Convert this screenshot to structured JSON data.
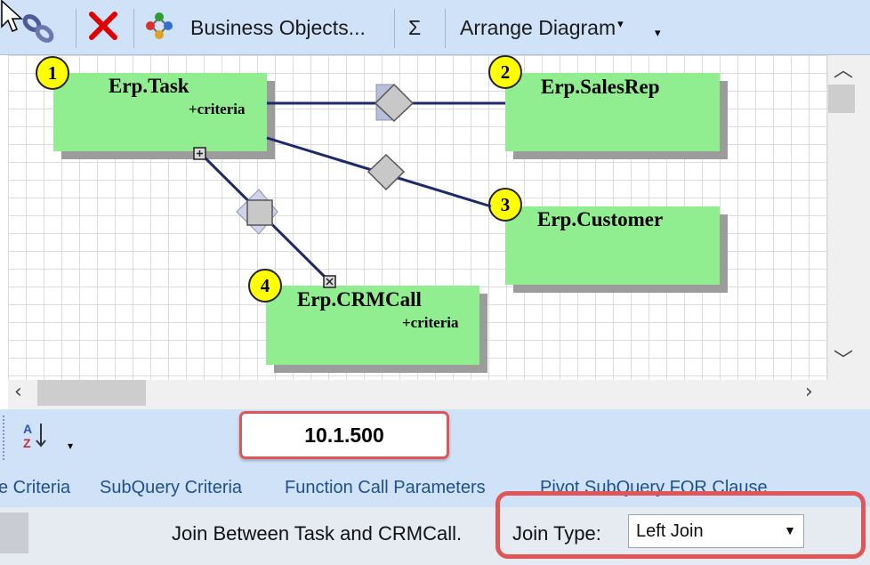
{
  "toolbar": {
    "business_objects_label": "Business Objects...",
    "sum_label": "Σ",
    "arrange_label": "Arrange Diagram",
    "arrange_caret": "▾",
    "overflow_caret": "▾"
  },
  "diagram": {
    "entities": [
      {
        "badge": "1",
        "name": "Erp.Task",
        "criteria": "+criteria"
      },
      {
        "badge": "2",
        "name": "Erp.SalesRep",
        "criteria": ""
      },
      {
        "badge": "3",
        "name": "Erp.Customer",
        "criteria": ""
      },
      {
        "badge": "4",
        "name": "Erp.CRMCall",
        "criteria": "+criteria"
      }
    ]
  },
  "properties": {
    "sort_icon_text": "A↓Z",
    "sort_caret": "▾",
    "version": "10.1.500",
    "tabs": [
      "e Criteria",
      "SubQuery Criteria",
      "Function Call Parameters",
      "Pivot SubQuery FOR Clause"
    ]
  },
  "join": {
    "description": "Join Between Task and CRMCall.",
    "type_label": "Join Type:",
    "type_value": "Left Join"
  },
  "icons": [
    "cursor-icon",
    "link-icon",
    "delete-icon",
    "business-objects-icon",
    "sum-icon",
    "sort-az-icon"
  ],
  "colors": {
    "entity_fill": "#90ee90",
    "badge_fill": "#ffff00",
    "line": "#1b2a6b",
    "toolbar_bg": "#cfe2f8",
    "highlight": "#e05555"
  }
}
